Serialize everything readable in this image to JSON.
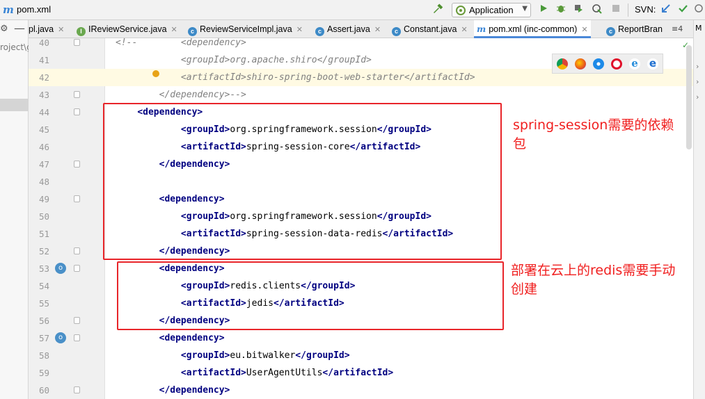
{
  "window": {
    "file_title": "pom.xml",
    "app_icon": "maven-m-icon"
  },
  "toolbar": {
    "run_config": "Application",
    "svn_label": "SVN:",
    "icons": [
      "hammer-icon",
      "run-icon",
      "debug-icon",
      "coverage-icon",
      "profile-icon",
      "stop-icon",
      "svn-update-icon",
      "svn-commit-icon"
    ]
  },
  "left_panel": {
    "project_label": "roject\\g"
  },
  "tabs": [
    {
      "label": "pl.java",
      "icon": "",
      "active": false
    },
    {
      "label": "IReviewService.java",
      "icon": "interface-icon",
      "active": false
    },
    {
      "label": "ReviewServiceImpl.java",
      "icon": "class-icon",
      "active": false
    },
    {
      "label": "Assert.java",
      "icon": "class-icon",
      "active": false
    },
    {
      "label": "Constant.java",
      "icon": "class-icon",
      "active": false
    },
    {
      "label": "pom.xml (inc-common)",
      "icon": "maven-icon",
      "active": true
    },
    {
      "label": "ReportBran",
      "icon": "class-icon",
      "active": false
    }
  ],
  "tabs_overflow": "≡4",
  "right_strip_label": "M",
  "lines": [
    {
      "n": "40",
      "text": "<!--        <dependency>",
      "comment": true
    },
    {
      "n": "41",
      "text": "            <groupId>org.apache.shiro</groupId>",
      "comment": true
    },
    {
      "n": "42",
      "text": "            <artifactId>shiro-spring-boot-web-starter</artifactId>",
      "comment": true
    },
    {
      "n": "43",
      "text": "        </dependency>-->",
      "comment": true
    },
    {
      "n": "44",
      "pre": "    ",
      "tag1": "<dependency>",
      "mid": "",
      "tag2": ""
    },
    {
      "n": "45",
      "pre": "            ",
      "tag1": "<groupId>",
      "mid": "org.springframework.session",
      "tag2": "</groupId>"
    },
    {
      "n": "46",
      "pre": "            ",
      "tag1": "<artifactId>",
      "mid": "spring-session-core",
      "tag2": "</artifactId>"
    },
    {
      "n": "47",
      "pre": "        ",
      "tag1": "</dependency>",
      "mid": "",
      "tag2": ""
    },
    {
      "n": "48",
      "pre": "",
      "tag1": "",
      "mid": "",
      "tag2": ""
    },
    {
      "n": "49",
      "pre": "        ",
      "tag1": "<dependency>",
      "mid": "",
      "tag2": ""
    },
    {
      "n": "50",
      "pre": "            ",
      "tag1": "<groupId>",
      "mid": "org.springframework.session",
      "tag2": "</groupId>"
    },
    {
      "n": "51",
      "pre": "            ",
      "tag1": "<artifactId>",
      "mid": "spring-session-data-redis",
      "tag2": "</artifactId>"
    },
    {
      "n": "52",
      "pre": "        ",
      "tag1": "</dependency>",
      "mid": "",
      "tag2": ""
    },
    {
      "n": "53",
      "pre": "        ",
      "tag1": "<dependency>",
      "mid": "",
      "tag2": ""
    },
    {
      "n": "54",
      "pre": "            ",
      "tag1": "<groupId>",
      "mid": "redis.clients",
      "tag2": "</groupId>"
    },
    {
      "n": "55",
      "pre": "            ",
      "tag1": "<artifactId>",
      "mid": "jedis",
      "tag2": "</artifactId>"
    },
    {
      "n": "56",
      "pre": "        ",
      "tag1": "</dependency>",
      "mid": "",
      "tag2": ""
    },
    {
      "n": "57",
      "pre": "        ",
      "tag1": "<dependency>",
      "mid": "",
      "tag2": ""
    },
    {
      "n": "58",
      "pre": "            ",
      "tag1": "<groupId>",
      "mid": "eu.bitwalker",
      "tag2": "</groupId>"
    },
    {
      "n": "59",
      "pre": "            ",
      "tag1": "<artifactId>",
      "mid": "UserAgentUtils",
      "tag2": "</artifactId>"
    },
    {
      "n": "60",
      "pre": "        ",
      "tag1": "</dependency>",
      "mid": "",
      "tag2": ""
    }
  ],
  "browsers": [
    "chrome-icon",
    "firefox-icon",
    "safari-icon",
    "opera-icon",
    "ie-icon",
    "edge-icon"
  ],
  "annotations": {
    "note1_line1": "spring-session需要的依赖",
    "note1_line2": "包",
    "note2_line1": "部署在云上的redis需要手动",
    "note2_line2": "创建",
    "color": "#e8252a"
  },
  "colors": {
    "xml_tag": "#000080",
    "comment": "#808080",
    "current_line": "#fffae3",
    "tab_active_underline": "#4a88d8"
  }
}
